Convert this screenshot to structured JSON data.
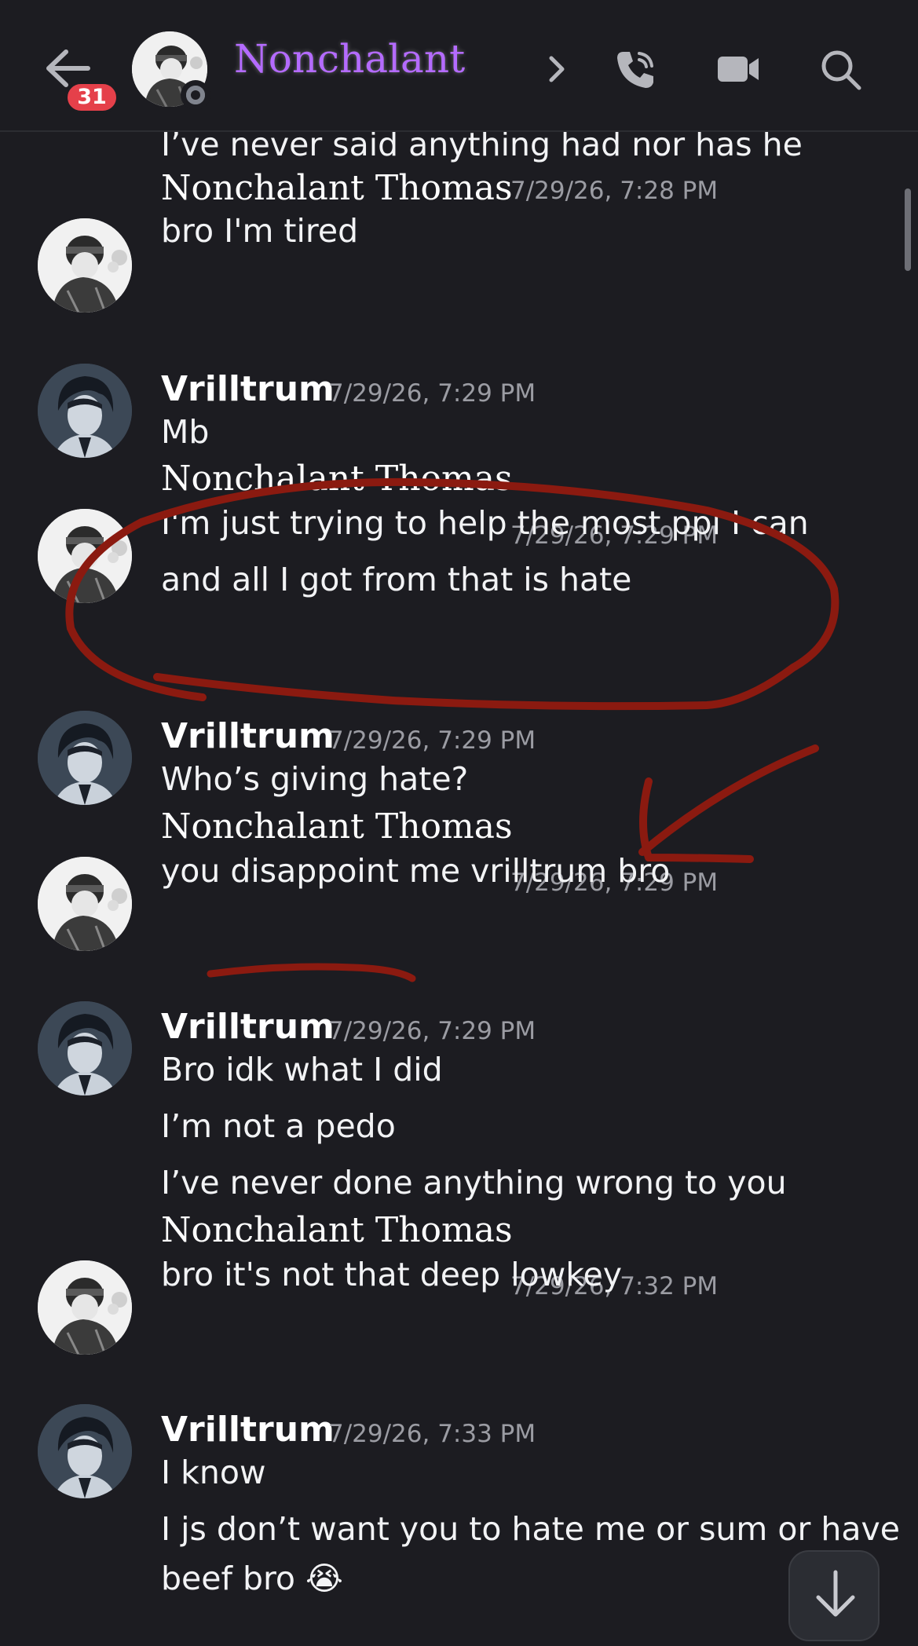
{
  "header": {
    "back_badge": "31",
    "title": "Nonchalant"
  },
  "chat": {
    "continuation_top": "I’ve never said anything had nor has he",
    "messages": [
      {
        "author": "Nonchalant Thomas",
        "timestamp": "7/29/26, 7:28 PM",
        "lines": [
          "bro I'm tired"
        ]
      },
      {
        "author": "Vrilltrum",
        "timestamp": "7/29/26, 7:29 PM",
        "lines": [
          "Mb"
        ]
      },
      {
        "author": "Nonchalant Thomas",
        "timestamp": "7/29/26, 7:29 PM",
        "lines": [
          "I'm just trying to help the most ppl I can",
          "and all I got from that is hate"
        ]
      },
      {
        "author": "Vrilltrum",
        "timestamp": "7/29/26, 7:29 PM",
        "lines": [
          "Who’s giving hate?"
        ]
      },
      {
        "author": "Nonchalant Thomas",
        "timestamp": "7/29/26, 7:29 PM",
        "lines": [
          "you disappoint me vrilltrum bro"
        ]
      },
      {
        "author": "Vrilltrum",
        "timestamp": "7/29/26, 7:29 PM",
        "lines": [
          "Bro idk what I did",
          "I’m not a pedo",
          "I’ve never done anything wrong to you"
        ]
      },
      {
        "author": "Nonchalant Thomas",
        "timestamp": "7/29/26, 7:32 PM",
        "lines": [
          "bro it's not that deep lowkey"
        ]
      },
      {
        "author": "Vrilltrum",
        "timestamp": "7/29/26, 7:33 PM",
        "lines": [
          "I know",
          "I js don’t want you to hate me or sum or have",
          "beef bro 😭"
        ]
      }
    ]
  },
  "icons": {
    "back": "arrow-left-icon",
    "chevron": "chevron-right-icon",
    "call": "phone-call-icon",
    "video": "video-camera-icon",
    "search": "search-icon",
    "jump": "arrow-down-icon"
  },
  "colors": {
    "background": "#1c1c21",
    "title": "#b46bff",
    "badge": "#e5404a",
    "timestamp": "#9b9ca3",
    "annotation": "#8b1a10"
  }
}
